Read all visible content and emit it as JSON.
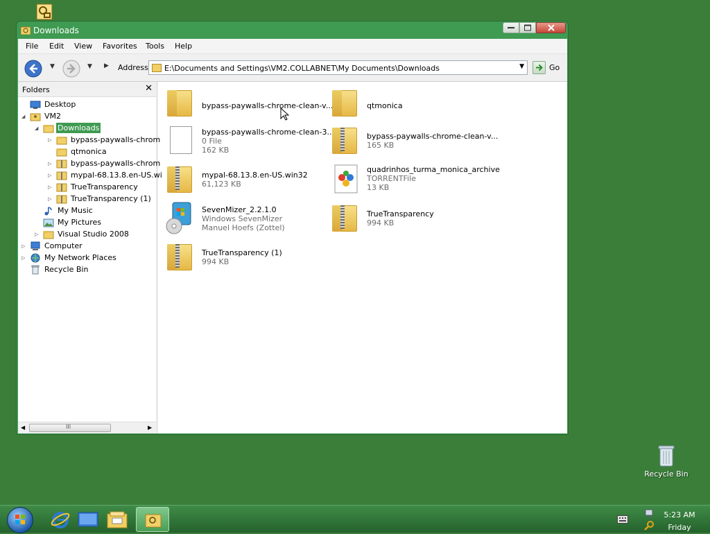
{
  "desktop": {
    "recycle_bin_label": "Recycle Bin"
  },
  "window": {
    "title": "Downloads",
    "menu": [
      "File",
      "Edit",
      "View",
      "Favorites",
      "Tools",
      "Help"
    ],
    "address_label": "Address",
    "address_value": "E:\\Documents and Settings\\VM2.COLLABNET\\My Documents\\Downloads",
    "go_label": "Go"
  },
  "folders_pane": {
    "title": "Folders",
    "close_glyph": "✕",
    "tree": [
      {
        "label": "Desktop",
        "icon": "desktop-icon",
        "expander": ""
      },
      {
        "label": "VM2",
        "icon": "user-folder-icon",
        "expander": "◢"
      },
      {
        "label": "Downloads",
        "icon": "folder-icon",
        "expander": "◢",
        "selected": true
      },
      {
        "label": "bypass-paywalls-chrom",
        "icon": "folder-icon",
        "expander": "▷"
      },
      {
        "label": "qtmonica",
        "icon": "folder-icon",
        "expander": ""
      },
      {
        "label": "bypass-paywalls-chrom",
        "icon": "zip-folder-icon",
        "expander": "▷"
      },
      {
        "label": "mypal-68.13.8.en-US.wi",
        "icon": "zip-folder-icon",
        "expander": "▷"
      },
      {
        "label": "TrueTransparency",
        "icon": "zip-folder-icon",
        "expander": "▷"
      },
      {
        "label": "TrueTransparency (1)",
        "icon": "zip-folder-icon",
        "expander": "▷"
      },
      {
        "label": "My Music",
        "icon": "music-icon",
        "expander": ""
      },
      {
        "label": "My Pictures",
        "icon": "pictures-icon",
        "expander": ""
      },
      {
        "label": "Visual Studio 2008",
        "icon": "folder-icon",
        "expander": "▷"
      },
      {
        "label": "Computer",
        "icon": "computer-icon",
        "expander": "▷"
      },
      {
        "label": "My Network Places",
        "icon": "network-icon",
        "expander": "▷"
      },
      {
        "label": "Recycle Bin",
        "icon": "recycle-bin-icon",
        "expander": ""
      }
    ],
    "scroll_glyph": "III"
  },
  "files": [
    {
      "name": "bypass-paywalls-chrome-clean-v...",
      "line2": "",
      "line3": "",
      "icon": "folder-icon"
    },
    {
      "name": "qtmonica",
      "line2": "",
      "line3": "",
      "icon": "folder-icon"
    },
    {
      "name": "bypass-paywalls-chrome-clean-3....",
      "line2": "0 File",
      "line3": "162 KB",
      "icon": "document-icon"
    },
    {
      "name": "bypass-paywalls-chrome-clean-v...",
      "line2": "165 KB",
      "line3": "",
      "icon": "zip-folder-icon"
    },
    {
      "name": "mypal-68.13.8.en-US.win32",
      "line2": "61,123 KB",
      "line3": "",
      "icon": "zip-folder-icon"
    },
    {
      "name": "quadrinhos_turma_monica_archive",
      "line2": "TORRENTFile",
      "line3": "13 KB",
      "icon": "torrent-file-icon"
    },
    {
      "name": "SevenMizer_2.2.1.0",
      "line2": "Windows SevenMizer",
      "line3": "Manuel Hoefs (Zottel)",
      "icon": "installer-icon"
    },
    {
      "name": "TrueTransparency",
      "line2": "994 KB",
      "line3": "",
      "icon": "zip-folder-icon"
    },
    {
      "name": "TrueTransparency (1)",
      "line2": "994 KB",
      "line3": "",
      "icon": "zip-folder-icon"
    }
  ],
  "taskbar": {
    "time": "5:23 AM",
    "day": "Friday"
  },
  "colors": {
    "desktop": "#3a7e3a",
    "accent": "#3f9a52"
  }
}
